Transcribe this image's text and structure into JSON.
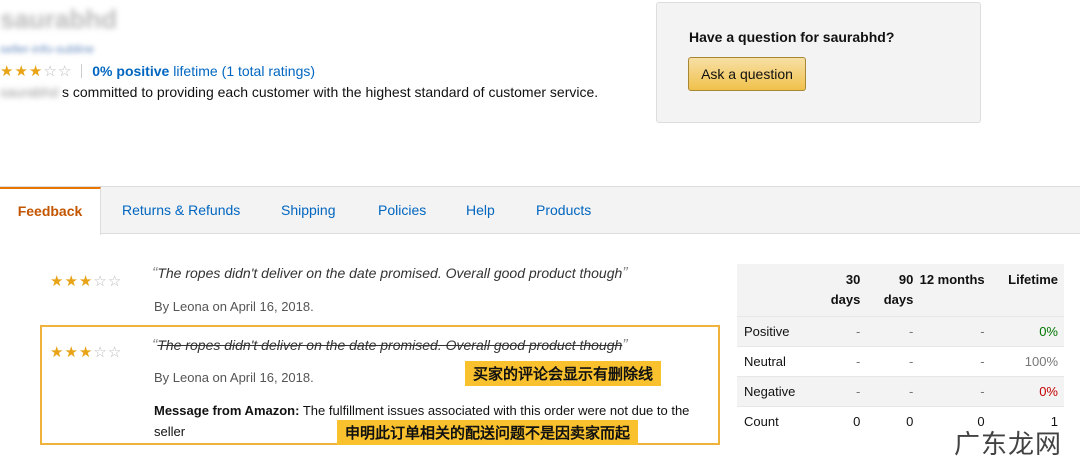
{
  "seller": {
    "name": "saurabhd",
    "subline": "seller-info-subline",
    "rating": {
      "stars": 3,
      "max": 5,
      "positive": "0% positive",
      "lifetime": "lifetime",
      "total": "(1 total ratings)"
    },
    "commit_prefix": "saurabhd",
    "commit_text": "s committed to providing each customer with the highest standard of customer service."
  },
  "question": {
    "title": "Have a question for saurabhd?",
    "button": "Ask a question"
  },
  "tabs": [
    {
      "label": "Feedback",
      "active": true
    },
    {
      "label": "Returns & Refunds"
    },
    {
      "label": "Shipping"
    },
    {
      "label": "Policies"
    },
    {
      "label": "Help"
    },
    {
      "label": "Products"
    }
  ],
  "feedback": [
    {
      "stars": 3,
      "quote": "The ropes didn't deliver on the date promised. Overall good product though",
      "by": "By Leona on April 16, 2018.",
      "struck": false
    },
    {
      "stars": 3,
      "quote": "The ropes didn't deliver on the date promised. Overall good product though",
      "by": "By Leona on April 16, 2018.",
      "struck": true,
      "message_label": "Message from Amazon:",
      "message_text": "The fulfillment issues associated with this order were not due to the seller"
    }
  ],
  "annotations": {
    "strike_note": "买家的评论会显示有删除线",
    "message_note": "申明此订单相关的配送问题不是因卖家而起"
  },
  "stats": {
    "headers": [
      "30 days",
      "90 days",
      "12 months",
      "Lifetime"
    ],
    "rows": [
      {
        "label": "Positive",
        "values": [
          "-",
          "-",
          "-",
          "0%"
        ]
      },
      {
        "label": "Neutral",
        "values": [
          "-",
          "-",
          "-",
          "100%"
        ]
      },
      {
        "label": "Negative",
        "values": [
          "-",
          "-",
          "-",
          "0%"
        ]
      },
      {
        "label": "Count",
        "values": [
          "0",
          "0",
          "0",
          "1"
        ]
      }
    ],
    "colors": {
      "positive": "#007600",
      "negative": "#c40000"
    }
  },
  "watermark": "广东龙网",
  "colors": {
    "link": "#0066c0",
    "star": "#e8a317",
    "active_tab": "#c45500",
    "highlight": "#f0b23a",
    "annotation_bg": "#f8c12d"
  }
}
